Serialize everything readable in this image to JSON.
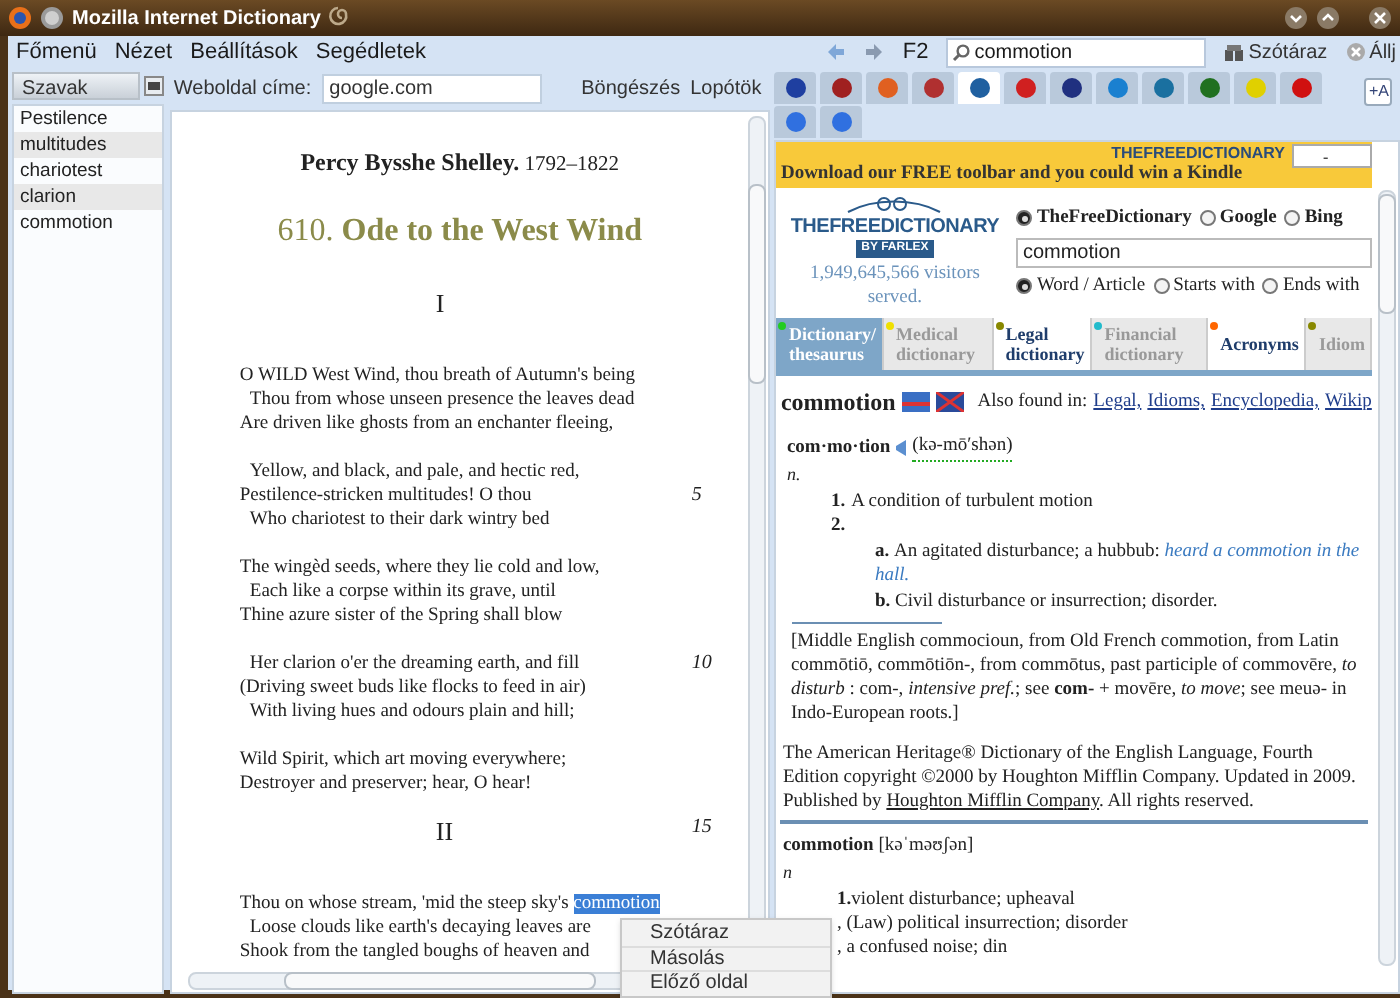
{
  "window": {
    "title": "Mozilla Internet Dictionary"
  },
  "menu": [
    "Főmenü",
    "Nézet",
    "Beállítások",
    "Segédletek"
  ],
  "toolbar": {
    "shortcut": "F2",
    "search": "commotion",
    "lookup_button": "Szótáraz",
    "stop_button": "Állj"
  },
  "words_panel": {
    "header": "Szavak",
    "items": [
      "Pestilence",
      "multitudes",
      "chariotest",
      "clarion",
      "commotion"
    ]
  },
  "address_bar": {
    "label": "Weboldal címe:",
    "value": "google.com",
    "buttons": [
      "Böngészés",
      "Lopótök"
    ]
  },
  "poem": {
    "author": "Percy Bysshe Shelley.",
    "years": "1792–1822",
    "title": "610. **Ode to the West Wind**",
    "sections": [
      {
        "heading": "I",
        "stanzas": [
          [
            {
              "text": "O WILD West Wind, thou breath of Autumn's being",
              "indent": false
            },
            {
              "text": "Thou from whose unseen presence the leaves dead",
              "indent": true
            },
            {
              "text": "Are driven like ghosts from an enchanter fleeing,",
              "indent": false
            }
          ],
          [
            {
              "text": "Yellow, and black, and pale, and hectic red,",
              "indent": true
            },
            {
              "text": "Pestilence-stricken multitudes! O thou",
              "indent": false,
              "number": "5"
            },
            {
              "text": "Who chariotest to their dark wintry bed",
              "indent": true
            }
          ],
          [
            {
              "text": "The wingèd seeds, where they lie cold and low,",
              "indent": false
            },
            {
              "text": "Each like a corpse within its grave, until",
              "indent": true
            },
            {
              "text": "Thine azure sister of the Spring shall blow",
              "indent": false
            }
          ],
          [
            {
              "text": "Her clarion o'er the dreaming earth, and fill",
              "indent": true,
              "number": "10"
            },
            {
              "text": "(Driving sweet buds like flocks to feed in air)",
              "indent": false
            },
            {
              "text": "With living hues and odours plain and hill;",
              "indent": true
            }
          ],
          [
            {
              "text": "Wild Spirit, which art moving everywhere;",
              "indent": false
            },
            {
              "text": "Destroyer and preserver; hear, O hear!",
              "indent": false
            }
          ]
        ]
      },
      {
        "heading": "II",
        "number": "15",
        "stanzas": [
          [
            {
              "text": "Thou on whose stream, 'mid the steep sky's ",
              "selected_word": "commotion",
              "indent": false
            },
            {
              "text": "Loose clouds like earth's decaying leaves are",
              "indent": true
            },
            {
              "text": "Shook from the tangled boughs of heaven and",
              "indent": false
            }
          ]
        ]
      }
    ]
  },
  "site_tabs": [
    {
      "color": "#1f3fa0",
      "selected": false
    },
    {
      "color": "#a02020",
      "selected": false
    },
    {
      "color": "#e06020",
      "selected": false
    },
    {
      "color": "#b03030",
      "selected": false
    },
    {
      "color": "#2060a0",
      "selected": true
    },
    {
      "color": "#d02020",
      "selected": false
    },
    {
      "color": "#203080",
      "selected": false
    },
    {
      "color": "#1a80d0",
      "selected": false
    },
    {
      "color": "#1a70a0",
      "selected": false
    },
    {
      "color": "#207020",
      "selected": false
    },
    {
      "color": "#e0d000",
      "selected": false
    },
    {
      "color": "#d01010",
      "selected": false
    },
    {
      "color": "#3070e0",
      "selected": false
    },
    {
      "color": "#3070e0",
      "selected": false
    }
  ],
  "font_button": "+A",
  "dictionary_page": {
    "banner": "Download our FREE toolbar and you could win a Kindle",
    "banner_logo": "THEFREEDICTIONARY",
    "banner_select": "-",
    "logo_top": "THEFREEDICTIONARY",
    "logo_bottom": "BY FARLEX",
    "visitors": "1,949,645,566 visitors served.",
    "engines": [
      {
        "label": "TheFreeDictionary",
        "selected": true
      },
      {
        "label": "Google",
        "selected": false
      },
      {
        "label": "Bing",
        "selected": false
      }
    ],
    "search_value": "commotion",
    "match_modes": [
      {
        "label": "Word / Article",
        "selected": true
      },
      {
        "label": "Starts with",
        "selected": false
      },
      {
        "label": "Ends with",
        "selected": false
      }
    ],
    "tabs": [
      {
        "label": "Dictionary/ thesaurus",
        "color": "#22cc22",
        "selected": true
      },
      {
        "label": "Medical dictionary",
        "color": "#f0e000",
        "selected": false
      },
      {
        "label": "Legal dictionary",
        "color": "#888800",
        "selected": false
      },
      {
        "label": "Financial dictionary",
        "color": "#22bbcc",
        "selected": false
      },
      {
        "label": "Acronyms",
        "color": "#ff6600",
        "selected": false
      },
      {
        "label": "Idiom",
        "color": "#888800",
        "selected": false
      }
    ],
    "headword": "commotion",
    "also_found_label": "Also found in:",
    "also_found": [
      "Legal,",
      "Idioms,",
      "Encyclopedia,",
      "Wikip"
    ],
    "syllables": "com·mo·tion",
    "pronunciation": "(kə-mō′shən)",
    "part_of_speech": "n.",
    "senses": [
      {
        "number": "1.",
        "text": "A condition of turbulent motion"
      },
      {
        "number": "2.",
        "subsenses": [
          {
            "letter": "a.",
            "text": "An agitated disturbance; a hubbub: ",
            "example": "heard a commotion in the hall."
          },
          {
            "letter": "b.",
            "text": "Civil disturbance or insurrection; disorder."
          }
        ]
      }
    ],
    "etymology": "[Middle English commocioun, from Old French commotion, from Latin commōtiō, commōtiōn-, from commōtus, past participle of commovēre, *to disturb* : com-, *intensive pref.*; see **com-** + movēre, *to move*; see meuə- in Indo-European roots.]",
    "copyright": "The American Heritage® Dictionary of the English Language, Fourth Edition copyright ©2000 by Houghton Mifflin Company. Updated in 2009. Published by ",
    "copyright_link": "Houghton Mifflin Company",
    "copyright_end": ". All rights reserved.",
    "entry2": {
      "headword": "commotion",
      "pronunciation": "[kəˈməʊʃən]",
      "part_of_speech": "n",
      "senses": [
        {
          "number": "1.",
          "text": "violent disturbance; upheaval"
        },
        {
          "text": ", (Law) political insurrection; disorder"
        },
        {
          "text": ", a confused noise; din"
        }
      ]
    }
  },
  "context_menu": [
    "Szótáraz",
    "Másolás",
    "Előző oldal"
  ]
}
